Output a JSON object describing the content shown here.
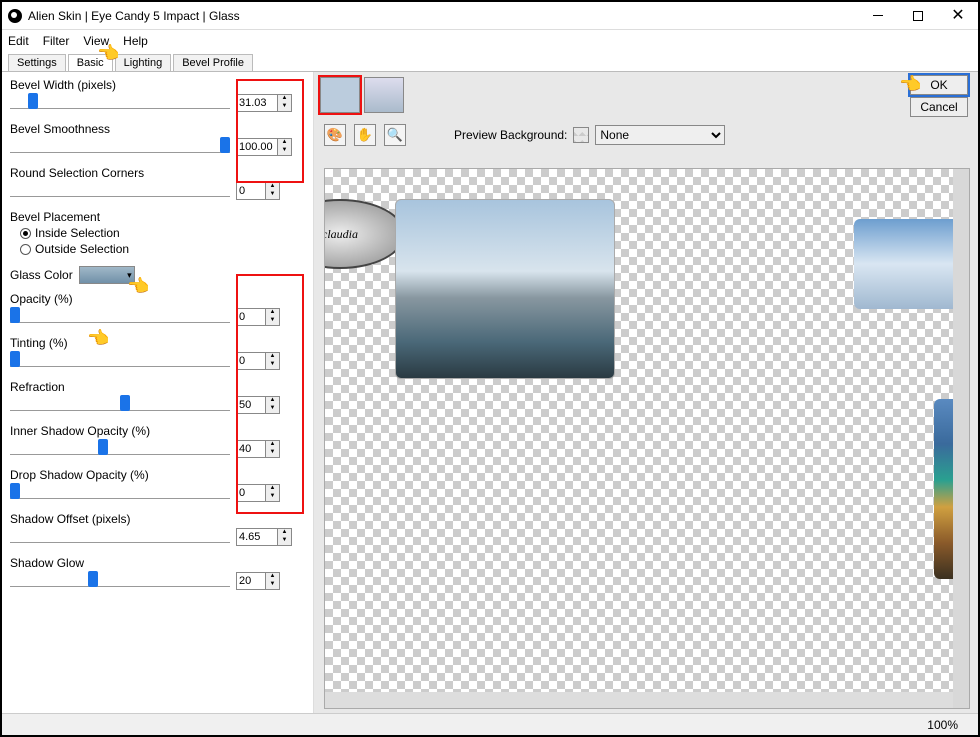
{
  "window": {
    "title": "Alien Skin | Eye Candy 5 Impact | Glass"
  },
  "menu": {
    "edit": "Edit",
    "filter": "Filter",
    "view": "View",
    "help": "Help"
  },
  "tabs": {
    "settings": "Settings",
    "basic": "Basic",
    "lighting": "Lighting",
    "bevel": "Bevel Profile"
  },
  "params": {
    "bevel_width": {
      "label": "Bevel Width (pixels)",
      "value": "31.03"
    },
    "bevel_smooth": {
      "label": "Bevel Smoothness",
      "value": "100.00"
    },
    "round_corners": {
      "label": "Round Selection Corners",
      "value": "0"
    },
    "placement": {
      "label": "Bevel Placement",
      "inside": "Inside Selection",
      "outside": "Outside Selection"
    },
    "glass_color": {
      "label": "Glass Color"
    },
    "opacity": {
      "label": "Opacity (%)",
      "value": "0"
    },
    "tinting": {
      "label": "Tinting (%)",
      "value": "0"
    },
    "refraction": {
      "label": "Refraction",
      "value": "50"
    },
    "inner_shadow": {
      "label": "Inner Shadow Opacity (%)",
      "value": "40"
    },
    "drop_shadow": {
      "label": "Drop Shadow Opacity (%)",
      "value": "0"
    },
    "shadow_offset": {
      "label": "Shadow Offset (pixels)",
      "value": "4.65"
    },
    "shadow_glow": {
      "label": "Shadow Glow",
      "value": "20"
    }
  },
  "right": {
    "preview_bg_label": "Preview Background:",
    "preview_bg_value": "None",
    "ok": "OK",
    "cancel": "Cancel"
  },
  "status": {
    "zoom": "100%"
  },
  "annotations": {
    "sig": "claudia"
  }
}
